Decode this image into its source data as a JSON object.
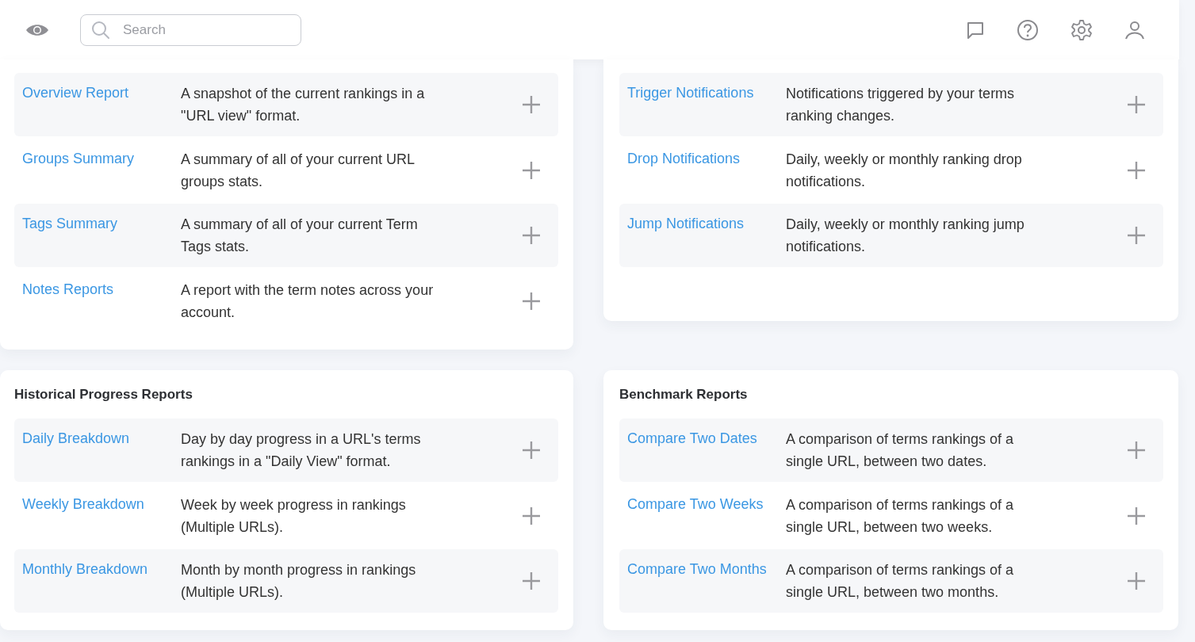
{
  "search": {
    "placeholder": "Search"
  },
  "sections": [
    {
      "items": [
        {
          "name": "Overview Report",
          "description": "A snapshot of the current rankings in a \"URL view\" format."
        },
        {
          "name": "Groups Summary",
          "description": "A summary of all of your current URL groups stats."
        },
        {
          "name": "Tags Summary",
          "description": "A summary of all of your current Term Tags stats."
        },
        {
          "name": "Notes Reports",
          "description": "A report with the term notes across your account."
        }
      ]
    },
    {
      "items": [
        {
          "name": "Trigger Notifications",
          "description": "Notifications triggered by your terms ranking changes."
        },
        {
          "name": "Drop Notifications",
          "description": "Daily, weekly or monthly ranking drop notifications."
        },
        {
          "name": "Jump Notifications",
          "description": "Daily, weekly or monthly ranking jump notifications."
        }
      ]
    },
    {
      "title": "Historical Progress Reports",
      "items": [
        {
          "name": "Daily Breakdown",
          "description": "Day by day progress in a URL's terms rankings in a \"Daily View\" format."
        },
        {
          "name": "Weekly Breakdown",
          "description": "Week by week progress in rankings (Multiple URLs)."
        },
        {
          "name": "Monthly Breakdown",
          "description": "Month by month progress in rankings (Multiple URLs)."
        }
      ]
    },
    {
      "title": "Benchmark Reports",
      "items": [
        {
          "name": "Compare Two Dates",
          "description": "A comparison of terms rankings of a single URL, between two dates."
        },
        {
          "name": "Compare Two Weeks",
          "description": "A comparison of terms rankings of a single URL, between two weeks."
        },
        {
          "name": "Compare Two Months",
          "description": "A comparison of terms rankings of a single URL, between two months."
        }
      ]
    }
  ]
}
